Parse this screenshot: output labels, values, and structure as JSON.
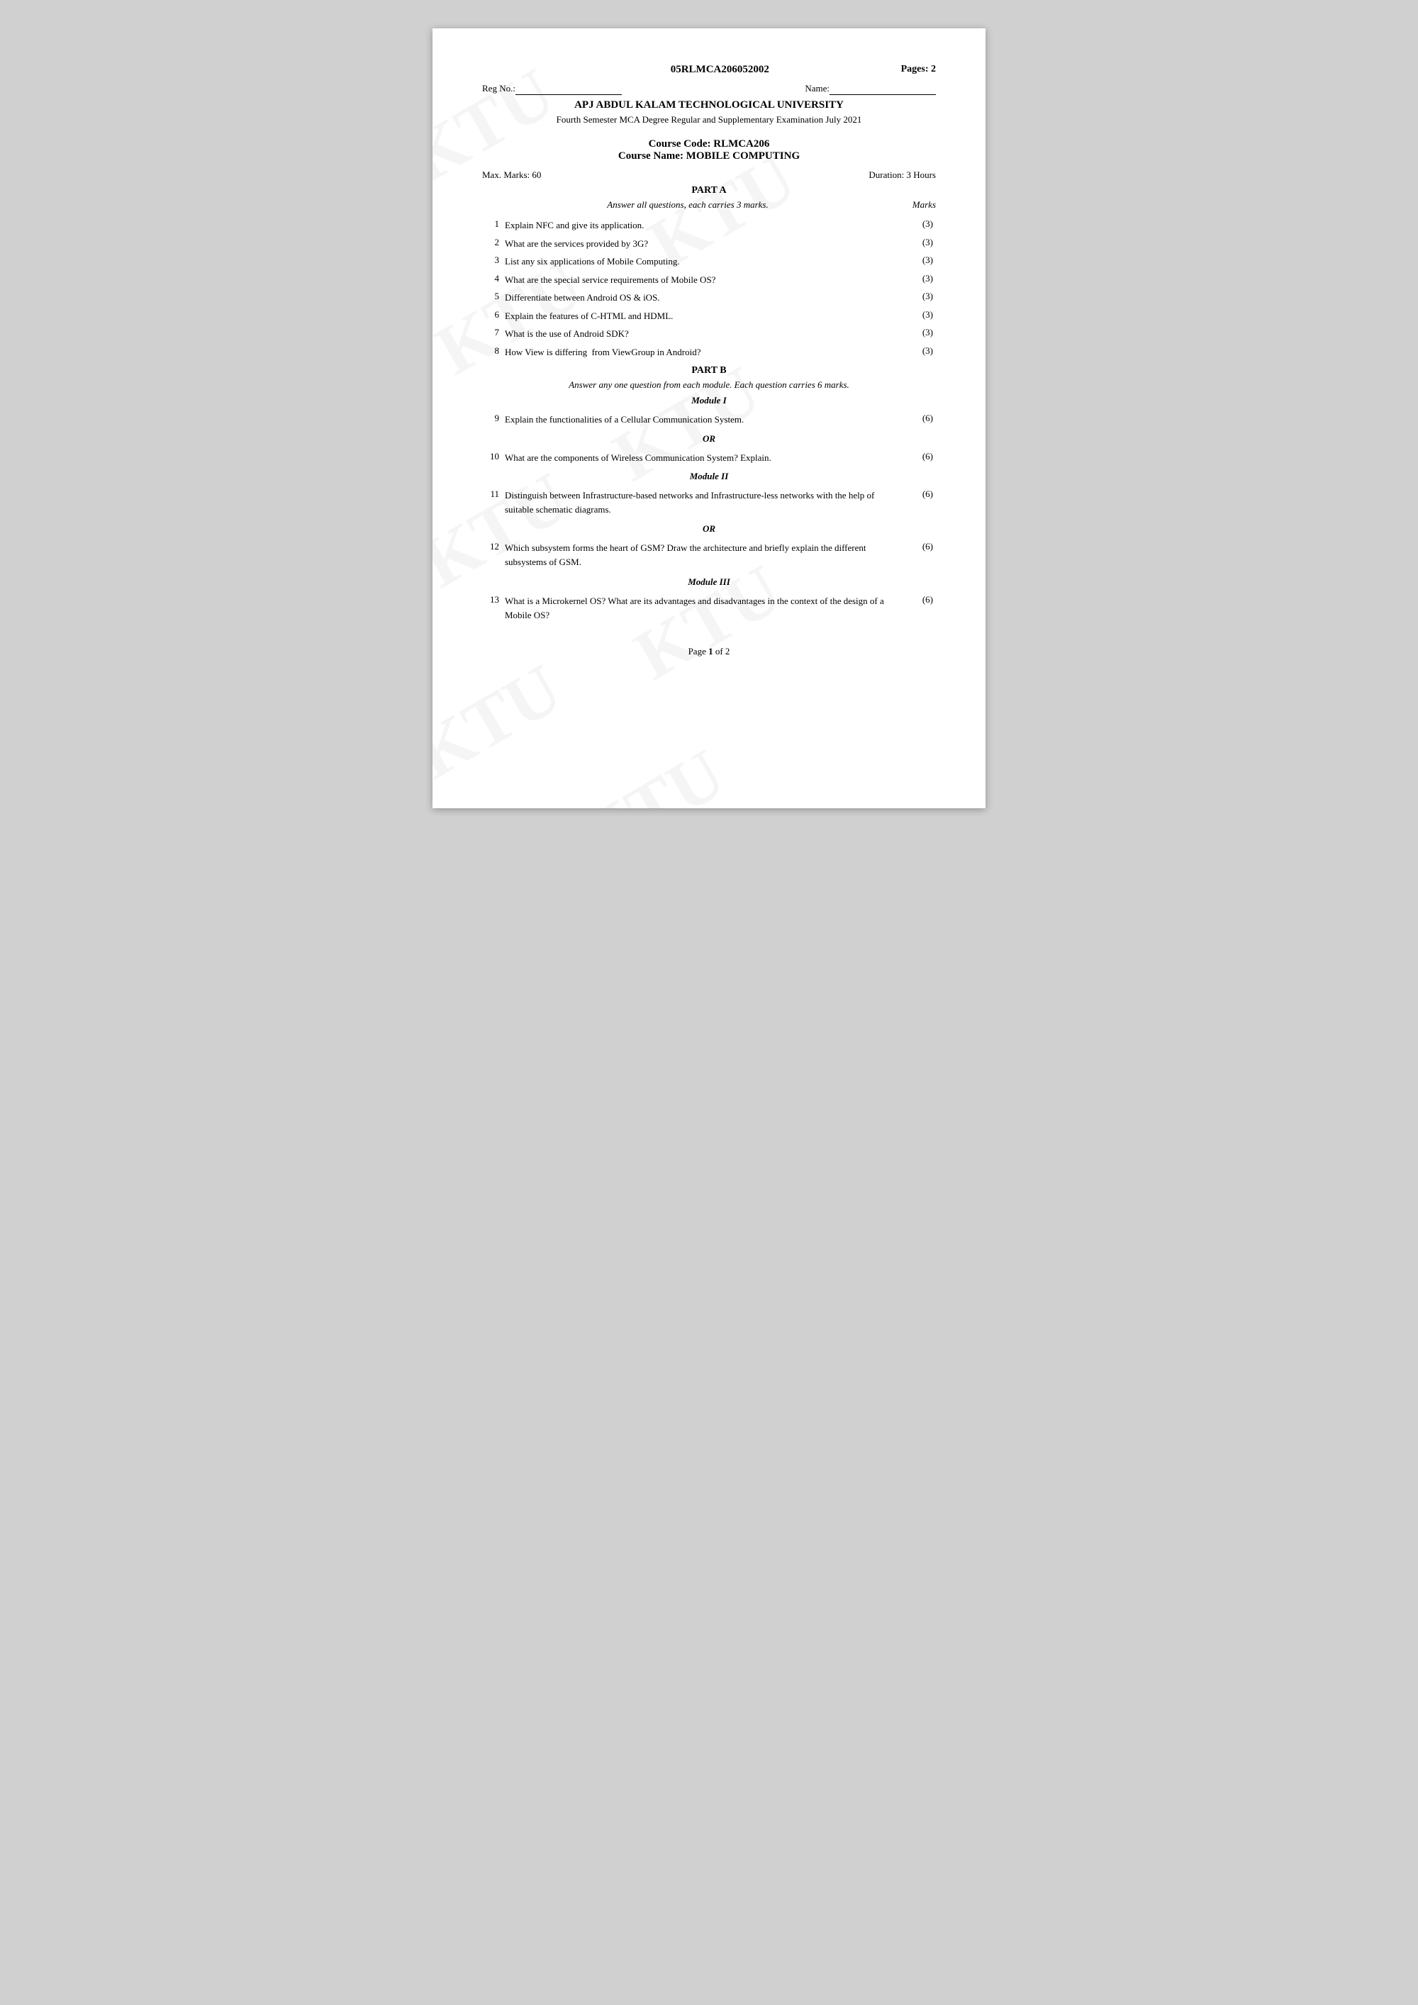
{
  "header": {
    "exam_code": "05RLMCA206052002",
    "pages_label": "Pages: 2",
    "reg_label": "Reg No.:",
    "name_label": "Name:",
    "university": "APJ ABDUL KALAM TECHNOLOGICAL UNIVERSITY",
    "exam_subtitle": "Fourth Semester MCA Degree Regular and Supplementary Examination July 2021"
  },
  "course": {
    "code_label": "Course Code: RLMCA206",
    "name_label": "Course Name: MOBILE COMPUTING",
    "max_marks": "Max. Marks: 60",
    "duration": "Duration: 3 Hours"
  },
  "part_a": {
    "title": "PART A",
    "instruction": "Answer all questions, each carries 3 marks.",
    "marks_col": "Marks",
    "questions": [
      {
        "num": "1",
        "text": "Explain NFC and give its application.",
        "marks": "(3)"
      },
      {
        "num": "2",
        "text": "What are the services provided by 3G?",
        "marks": "(3)"
      },
      {
        "num": "3",
        "text": "List any six applications of Mobile Computing.",
        "marks": "(3)"
      },
      {
        "num": "4",
        "text": "What are the special service requirements of Mobile OS?",
        "marks": "(3)"
      },
      {
        "num": "5",
        "text": "Differentiate between Android OS & iOS.",
        "marks": "(3)"
      },
      {
        "num": "6",
        "text": "Explain the features of C-HTML and HDML.",
        "marks": "(3)"
      },
      {
        "num": "7",
        "text": "What is the use of Android SDK?",
        "marks": "(3)"
      },
      {
        "num": "8",
        "text": "How View is differing  from ViewGroup in Android?",
        "marks": "(3)"
      }
    ]
  },
  "part_b": {
    "title": "PART B",
    "instruction": "Answer any one question from each module.  Each question carries 6 marks.",
    "modules": [
      {
        "title": "Module I",
        "questions": [
          {
            "num": "9",
            "text": "Explain the functionalities of a Cellular Communication System.",
            "marks": "(6)"
          }
        ],
        "or": "OR",
        "or_questions": [
          {
            "num": "10",
            "text": "What are the components of Wireless Communication System? Explain.",
            "marks": "(6)"
          }
        ]
      },
      {
        "title": "Module II",
        "questions": [
          {
            "num": "11",
            "text": "Distinguish between Infrastructure-based networks and Infrastructure-less networks with the help of suitable schematic diagrams.",
            "marks": "(6)"
          }
        ],
        "or": "OR",
        "or_questions": [
          {
            "num": "12",
            "text": "Which subsystem forms the heart of GSM? Draw the architecture and briefly explain the different subsystems of GSM.",
            "marks": "(6)"
          }
        ]
      },
      {
        "title": "Module III",
        "questions": [
          {
            "num": "13",
            "text": "What is a Microkernel OS? What are its advantages and disadvantages in the context of the design of a Mobile OS?",
            "marks": "(6)"
          }
        ]
      }
    ]
  },
  "footer": {
    "page_text": "Page ",
    "page_bold": "1",
    "page_of": " of ",
    "page_total": "2"
  }
}
